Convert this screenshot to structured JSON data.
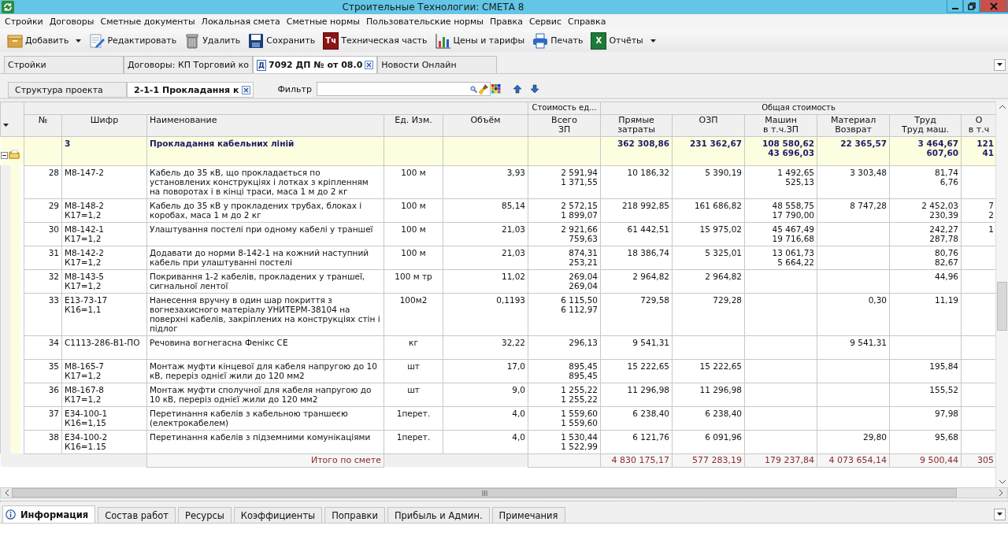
{
  "window": {
    "title": "Строительные Технологии: СМЕТА 8"
  },
  "menu": [
    "Стройки",
    "Договоры",
    "Сметные документы",
    "Локальная смета",
    "Сметные нормы",
    "Пользовательские нормы",
    "Правка",
    "Сервис",
    "Справка"
  ],
  "toolbar": [
    {
      "label": "Добавить",
      "kind": "add",
      "dropdown": true
    },
    {
      "label": "Редактировать",
      "kind": "edit",
      "dropdown": false
    },
    {
      "label": "Удалить",
      "kind": "delete",
      "dropdown": false
    },
    {
      "label": "Сохранить",
      "kind": "save",
      "dropdown": false
    },
    {
      "label": "Техническая часть",
      "kind": "letters",
      "icon_text": "Тч",
      "dropdown": false
    },
    {
      "label": "Цены и тарифы",
      "kind": "chart",
      "dropdown": false
    },
    {
      "label": "Печать",
      "kind": "print",
      "dropdown": false
    },
    {
      "label": "Отчёты",
      "kind": "sheet",
      "icon_text": "X",
      "dropdown": true
    }
  ],
  "document_tabs": [
    {
      "label": "Стройки",
      "selected": false,
      "closable": false
    },
    {
      "label": "Договоры: КП Торговий ко",
      "selected": false,
      "closable": false
    },
    {
      "label": "7092 ДП №  от 08.0",
      "icon_text": "Д",
      "selected": true,
      "closable": true
    },
    {
      "label": "Новости Онлайн",
      "selected": false,
      "closable": false
    }
  ],
  "project_tabs": [
    {
      "label": "Структура проекта",
      "selected": false,
      "closable": false
    },
    {
      "label": "2-1-1 Прокладання к",
      "selected": true,
      "closable": true
    }
  ],
  "filter": {
    "label": "Фильтр"
  },
  "table": {
    "column_groups": [
      {
        "label": "Стоимость ед..."
      },
      {
        "label": "Общая стоимость"
      }
    ],
    "columns": [
      "№",
      "Шифр",
      "Наименование",
      "Ед. Изм.",
      "Объём",
      "Всего\nЗП",
      "Прямые\nзатраты",
      "ОЗП",
      "Машин\nв т.ч.ЗП",
      "Материал\nВозврат",
      "Труд\nТруд маш.",
      "О\nв т.ч"
    ],
    "rows": [
      {
        "kind": "group",
        "expanded": true,
        "cells": [
          null,
          "3",
          "Прокладання кабельних ліній",
          null,
          null,
          null,
          "362 308,86",
          "231 362,67",
          "108 580,62\n43 696,03",
          "22 365,57",
          "3 464,67\n607,60",
          "121\n41"
        ]
      },
      {
        "kind": "item",
        "cells": [
          "28",
          "М8-147-2",
          "Кабель до 35 кВ, що прокладається по установлених конструкціях і лотках з кріпленням на поворотах і в кінці траси, маса 1 м до 2 кг",
          "100 м",
          "3,93",
          "2 591,94\n1 371,55",
          "10 186,32",
          "5 390,19",
          "1 492,65\n525,13",
          "3 303,48",
          "81,74\n6,76",
          null
        ]
      },
      {
        "kind": "item",
        "cells": [
          "29",
          "М8-148-2\nК17=1,2",
          "Кабель до 35 кВ у прокладених трубах, блоках і коробах, маса 1 м до 2 кг",
          "100 м",
          "85,14",
          "2 572,15\n1 899,07",
          "218 992,85",
          "161 686,82",
          "48 558,75\n17 790,00",
          "8 747,28",
          "2 452,03\n230,39",
          "7\n2"
        ]
      },
      {
        "kind": "item",
        "cells": [
          "30",
          "М8-142-1\nК17=1,2",
          "Улаштування постелі при одному кабелі у траншеї",
          "100 м",
          "21,03",
          "2 921,66\n759,63",
          "61 442,51",
          "15 975,02",
          "45 467,49\n19 716,68",
          null,
          "242,27\n287,78",
          "1"
        ]
      },
      {
        "kind": "item",
        "cells": [
          "31",
          "М8-142-2\nК17=1,2",
          "Додавати до норми 8-142-1 на кожний наступний кабель при улаштуванні постелі",
          "100 м",
          "21,03",
          "874,31\n253,21",
          "18 386,74",
          "5 325,01",
          "13 061,73\n5 664,22",
          null,
          "80,76\n82,67",
          null
        ]
      },
      {
        "kind": "item",
        "cells": [
          "32",
          "М8-143-5\nК17=1,2",
          "Покривання 1-2 кабелів, прокладених у траншеї, сигнальної лентої",
          "100 м тр",
          "11,02",
          "269,04\n269,04",
          "2 964,82",
          "2 964,82",
          null,
          null,
          "44,96",
          null
        ]
      },
      {
        "kind": "item",
        "cells": [
          "33",
          "Е13-73-17\nК16=1,1",
          "Нанесення вручну в один шар покриття з вогнезахисного матеріалу УНИТЕРМ-38104 на поверхні кабелів, закріплених на конструкціях стін і підлог",
          "100м2",
          "0,1193",
          "6 115,50\n6 112,97",
          "729,58",
          "729,28",
          null,
          "0,30",
          "11,19",
          null
        ]
      },
      {
        "kind": "item",
        "cells": [
          "34",
          "С1113-286-В1-ПО",
          "Речовина вогнегасна Фенікс СЕ",
          "кг",
          "32,22",
          "296,13",
          "9 541,31",
          null,
          null,
          "9 541,31",
          null,
          null
        ]
      },
      {
        "kind": "item",
        "cells": [
          "35",
          "М8-165-7\nК17=1,2",
          "Монтаж муфти кінцевої для кабеля напругою до 10 кВ, переріз однієї жили до 120 мм2",
          "шт",
          "17,0",
          "895,45\n895,45",
          "15 222,65",
          "15 222,65",
          null,
          null,
          "195,84",
          null
        ]
      },
      {
        "kind": "item",
        "cells": [
          "36",
          "М8-167-8\nК17=1,2",
          "Монтаж муфти сполучної для кабеля напругою до 10 кВ, переріз однієї жили до 120 мм2",
          "шт",
          "9,0",
          "1 255,22\n1 255,22",
          "11 296,98",
          "11 296,98",
          null,
          null,
          "155,52",
          null
        ]
      },
      {
        "kind": "item",
        "cells": [
          "37",
          "Е34-100-1\nК16=1,15",
          "Перетинання кабелів з кабельною траншеєю (електрокабелем)",
          "1перет.",
          "4,0",
          "1 559,60\n1 559,60",
          "6 238,40",
          "6 238,40",
          null,
          null,
          "97,98",
          null
        ]
      },
      {
        "kind": "item",
        "cells": [
          "38",
          "Е34-100-2\nК16=1.15",
          "Перетинання кабелів з підземними комунікаціями",
          "1перет.",
          "4,0",
          "1 530,44\n1 522,99",
          "6 121,76",
          "6 091,96",
          null,
          "29,80",
          "95,68",
          null
        ]
      }
    ],
    "total": {
      "label": "Итого по смете",
      "values": [
        "4 830 175,17",
        "577 283,19",
        "179 237,84",
        "4 073 654,14",
        "9 500,44",
        "305"
      ]
    }
  },
  "bottom_tabs": [
    {
      "label": "Информация",
      "kind": "info",
      "selected": true
    },
    {
      "label": "Состав работ",
      "kind": "plain",
      "selected": false
    },
    {
      "label": "Ресурсы",
      "kind": "plain",
      "selected": false
    },
    {
      "label": "Коэффициенты",
      "kind": "plain",
      "selected": false
    },
    {
      "label": "Поправки",
      "kind": "plain",
      "selected": false
    },
    {
      "label": "Прибыль и Админ.",
      "kind": "plain",
      "selected": false
    },
    {
      "label": "Примечания",
      "kind": "plain",
      "selected": false
    }
  ]
}
